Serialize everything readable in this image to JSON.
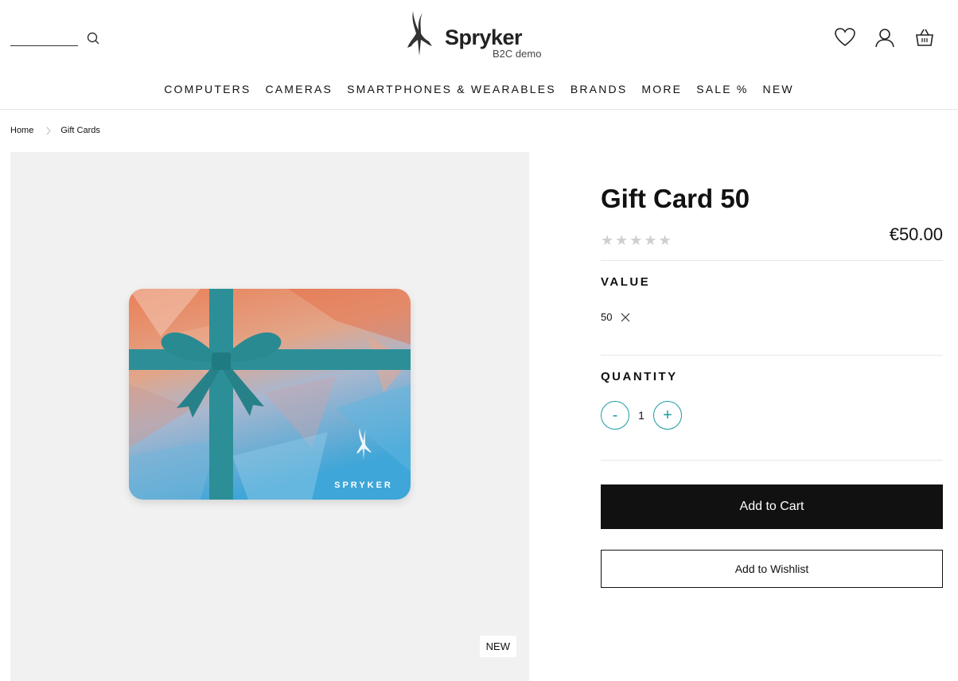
{
  "header": {
    "search_placeholder": "",
    "logo": {
      "name": "Spryker",
      "sub": "B2C demo"
    },
    "icons": [
      "search-icon",
      "heart-icon",
      "user-icon",
      "cart-icon"
    ]
  },
  "nav": {
    "items": [
      "COMPUTERS",
      "CAMERAS",
      "SMARTPHONES & WEARABLES",
      "BRANDS",
      "MORE",
      "SALE %",
      "NEW"
    ]
  },
  "breadcrumb": {
    "home": "Home",
    "current": "Gift Cards"
  },
  "product": {
    "title": "Gift Card 50",
    "price": "€50.00",
    "rating": 0,
    "rating_max": 5,
    "badge": "NEW",
    "image_brand": "SPRYKER"
  },
  "value_section": {
    "label": "VALUE",
    "selected": "50"
  },
  "quantity_section": {
    "label": "QUANTITY",
    "minus": "-",
    "value": "1",
    "plus": "+"
  },
  "actions": {
    "add_to_cart": "Add to Cart",
    "add_to_wishlist": "Add to Wishlist"
  },
  "colors": {
    "accent": "#1a9ba3",
    "primary_button": "#111111",
    "image_bg": "#f1f1f1"
  }
}
